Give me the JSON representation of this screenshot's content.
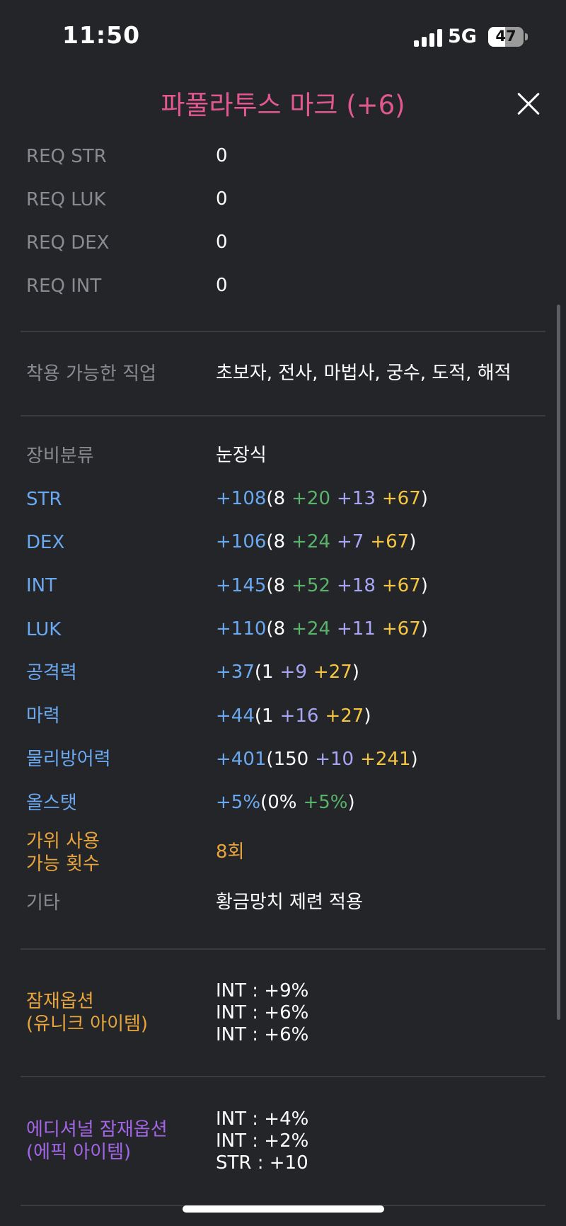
{
  "status_bar": {
    "time": "11:50",
    "network": "5G",
    "battery": "47",
    "battery_level": 0.47
  },
  "title": "파풀라투스 마크 (+6)",
  "requirements": [
    {
      "label": "REQ STR",
      "value": "0"
    },
    {
      "label": "REQ LUK",
      "value": "0"
    },
    {
      "label": "REQ DEX",
      "value": "0"
    },
    {
      "label": "REQ INT",
      "value": "0"
    }
  ],
  "jobs": {
    "label": "착용 가능한 직업",
    "value": "초보자, 전사, 마법사, 궁수, 도적, 해적"
  },
  "category": {
    "label": "장비분류",
    "value": "눈장식"
  },
  "stats": [
    {
      "label": "STR",
      "total": "+108",
      "open": "(",
      "base": "8",
      "parts": [
        {
          "text": "+20",
          "color": "#5ab36a"
        },
        {
          "text": "+13",
          "color": "#a8a5f5"
        },
        {
          "text": "+67",
          "color": "#f5c542"
        }
      ],
      "close": ")"
    },
    {
      "label": "DEX",
      "total": "+106",
      "open": "(",
      "base": "8",
      "parts": [
        {
          "text": "+24",
          "color": "#5ab36a"
        },
        {
          "text": "+7",
          "color": "#a8a5f5"
        },
        {
          "text": "+67",
          "color": "#f5c542"
        }
      ],
      "close": ")"
    },
    {
      "label": "INT",
      "total": "+145",
      "open": "(",
      "base": "8",
      "parts": [
        {
          "text": "+52",
          "color": "#5ab36a"
        },
        {
          "text": "+18",
          "color": "#a8a5f5"
        },
        {
          "text": "+67",
          "color": "#f5c542"
        }
      ],
      "close": ")"
    },
    {
      "label": "LUK",
      "total": "+110",
      "open": "(",
      "base": "8",
      "parts": [
        {
          "text": "+24",
          "color": "#5ab36a"
        },
        {
          "text": "+11",
          "color": "#a8a5f5"
        },
        {
          "text": "+67",
          "color": "#f5c542"
        }
      ],
      "close": ")"
    },
    {
      "label": "공격력",
      "total": "+37",
      "open": "(",
      "base": "1",
      "parts": [
        {
          "text": "+9",
          "color": "#a8a5f5"
        },
        {
          "text": "+27",
          "color": "#f5c542"
        }
      ],
      "close": ")"
    },
    {
      "label": "마력",
      "total": "+44",
      "open": "(",
      "base": "1",
      "parts": [
        {
          "text": "+16",
          "color": "#a8a5f5"
        },
        {
          "text": "+27",
          "color": "#f5c542"
        }
      ],
      "close": ")"
    },
    {
      "label": "물리방어력",
      "total": "+401",
      "open": "(",
      "base": "150",
      "parts": [
        {
          "text": "+10",
          "color": "#a8a5f5"
        },
        {
          "text": "+241",
          "color": "#f5c542"
        }
      ],
      "close": ")"
    },
    {
      "label": "올스탯",
      "total": "+5%",
      "open": "(",
      "base": "0%",
      "parts": [
        {
          "text": "+5%",
          "color": "#5ab36a"
        }
      ],
      "close": ")"
    }
  ],
  "scissors": {
    "label_line1": "가위 사용",
    "label_line2": "가능 횟수",
    "value": "8회"
  },
  "etc": {
    "label": "기타",
    "value": "황금망치 제련 적용"
  },
  "potential": {
    "label_line1": "잠재옵션",
    "label_line2": "(유니크 아이템)",
    "lines": [
      "INT : +9%",
      "INT : +6%",
      "INT : +6%"
    ]
  },
  "additional": {
    "label_line1": "에디셔널 잠재옵션",
    "label_line2": "(에픽 아이템)",
    "lines": [
      "INT : +4%",
      "INT : +2%",
      "STR : +10"
    ]
  },
  "colors": {
    "background": "#242529",
    "title": "#e0588f",
    "stat_label": "#6aa8f0",
    "stat_total": "#6aa8f0",
    "unique": "#e8a53c",
    "epic": "#a366e6",
    "gray_label": "#8a8b90"
  }
}
